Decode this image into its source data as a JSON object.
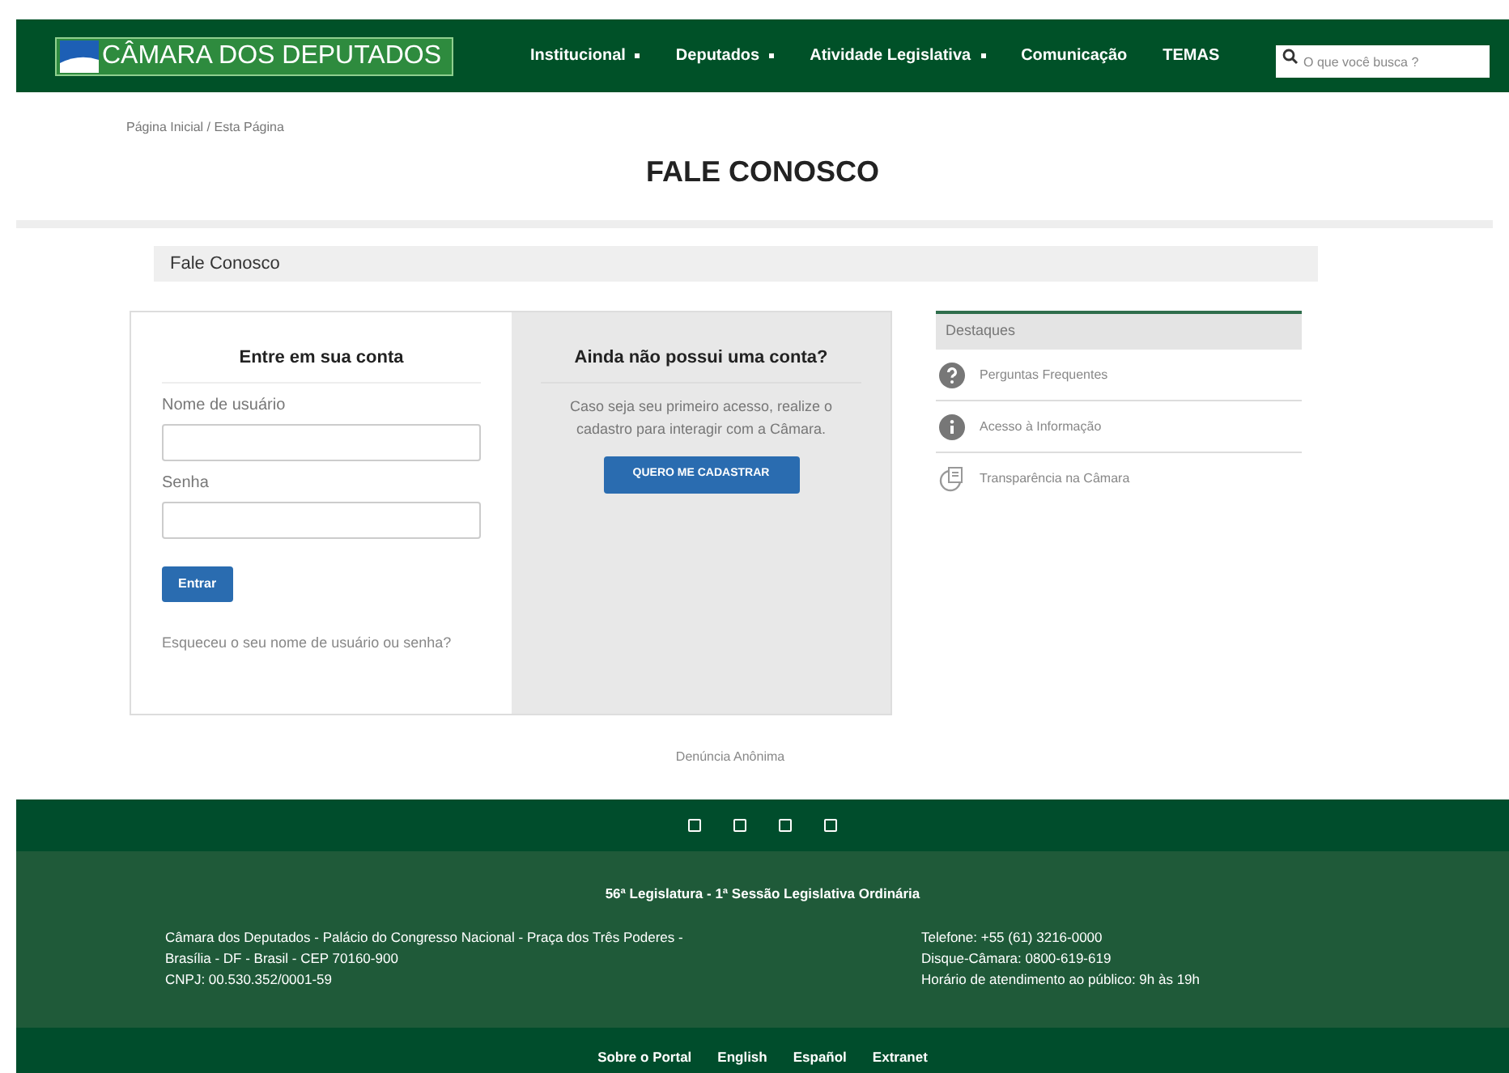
{
  "header": {
    "logo_text": "CÂMARA DOS DEPUTADOS",
    "nav": [
      {
        "label": "Institucional",
        "dropdown": true
      },
      {
        "label": "Deputados",
        "dropdown": true
      },
      {
        "label": "Atividade Legislativa",
        "dropdown": true
      },
      {
        "label": "Comunicação",
        "dropdown": false
      },
      {
        "label": "TEMAS",
        "dropdown": false
      }
    ],
    "search": {
      "placeholder": "O que você busca ?"
    }
  },
  "breadcrumb": "Página Inicial / Esta Página",
  "page_title": "FALE CONOSCO",
  "section_bar": "Fale Conosco",
  "login": {
    "title": "Entre em sua conta",
    "fields": [
      {
        "label": "Nome de usuário"
      },
      {
        "label": "Senha"
      }
    ],
    "submit": "Entrar",
    "forgot_link": "Esqueceu o seu nome de usuário ou senha?"
  },
  "register": {
    "title": "Ainda não possui uma conta?",
    "text": "Caso seja seu primeiro acesso, realize o cadastro para interagir com a Câmara.",
    "button": "QUERO ME CADASTRAR"
  },
  "highlights": {
    "title": "Destaques",
    "items": [
      {
        "kind": "question",
        "label": "Perguntas Frequentes"
      },
      {
        "kind": "info",
        "label": "Acesso à Informação"
      },
      {
        "kind": "transparency",
        "label": "Transparência na Câmara"
      }
    ]
  },
  "anonymous_link": "Denúncia Anônima",
  "footer": {
    "social_icons": [
      {
        "kind": "square"
      },
      {
        "kind": "square"
      },
      {
        "kind": "square"
      },
      {
        "kind": "square"
      }
    ],
    "legislature": "56ª Legislatura - 1ª Sessão Legislativa Ordinária",
    "address_lines": [
      "Câmara dos Deputados - Palácio do Congresso Nacional - Praça dos Três Poderes -",
      "Brasília - DF - Brasil - CEP 70160-900",
      "CNPJ: 00.530.352/0001-59"
    ],
    "contact_lines": [
      "Telefone: +55 (61) 3216-0000",
      "Disque-Câmara: 0800-619-619",
      "Horário de atendimento ao público: 9h às 19h"
    ],
    "links": [
      "Sobre o Portal",
      "English",
      "Español",
      "Extranet"
    ]
  }
}
